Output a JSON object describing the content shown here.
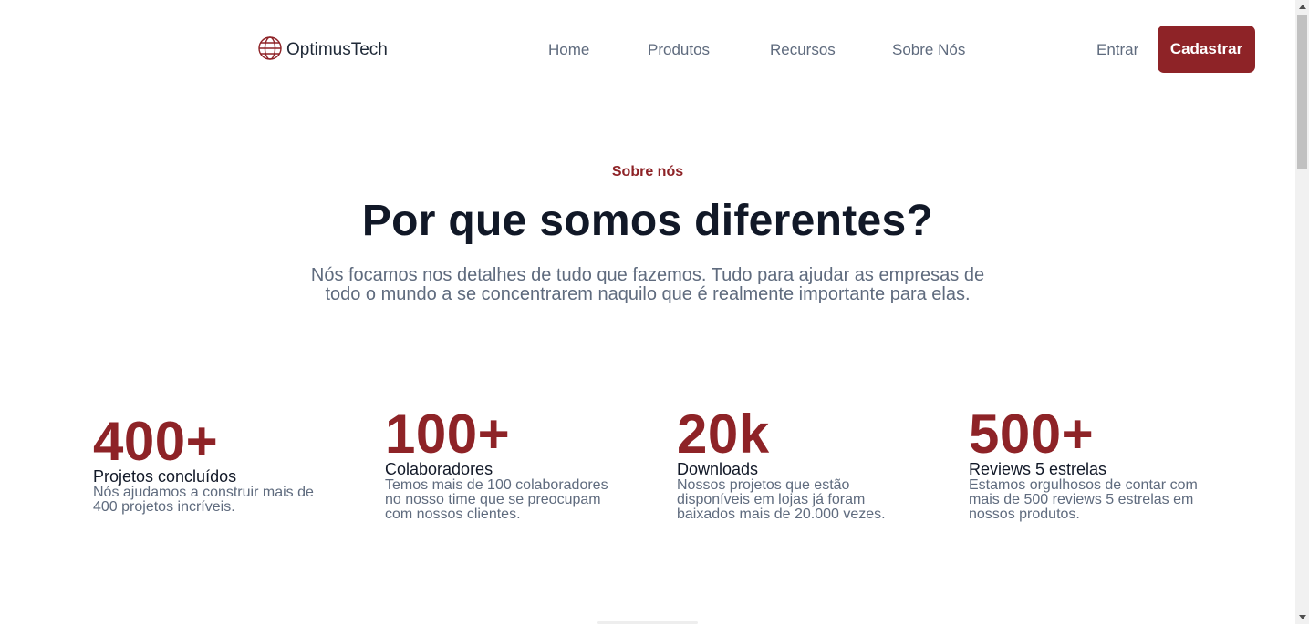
{
  "header": {
    "logo_text": "OptimusTech",
    "logo_icon": "globe-icon",
    "nav": [
      {
        "label": "Home"
      },
      {
        "label": "Produtos"
      },
      {
        "label": "Recursos"
      },
      {
        "label": "Sobre Nós"
      }
    ],
    "login_label": "Entrar",
    "signup_label": "Cadastrar"
  },
  "hero": {
    "eyebrow": "Sobre nós",
    "title": "Por que somos diferentes?",
    "subtitle_line1": "Nós focamos nos detalhes de tudo que fazemos. Tudo para ajudar as empresas de",
    "subtitle_line2": "todo o mundo a se concentrarem naquilo que é realmente importante para elas."
  },
  "stats": [
    {
      "number": "400+",
      "label": "Projetos concluídos",
      "desc": [
        "Nós ajudamos a construir mais de",
        "400 projetos incríveis."
      ]
    },
    {
      "number": "100+",
      "label": "Colaboradores",
      "desc": [
        "Temos mais de 100 colaboradores",
        "no nosso time que se preocupam",
        "com nossos clientes."
      ]
    },
    {
      "number": "20k",
      "label": "Downloads",
      "desc": [
        "Nossos projetos que estão",
        "disponíveis em lojas já foram",
        "baixados mais de 20.000 vezes."
      ]
    },
    {
      "number": "500+",
      "label": "Reviews 5 estrelas",
      "desc": [
        "Estamos orgulhosos de contar com",
        "mais de 500 reviews 5 estrelas em",
        "nossos produtos."
      ]
    }
  ],
  "colors": {
    "brand": "#8e2327",
    "heading": "#111827",
    "muted": "#5f6b7e"
  }
}
